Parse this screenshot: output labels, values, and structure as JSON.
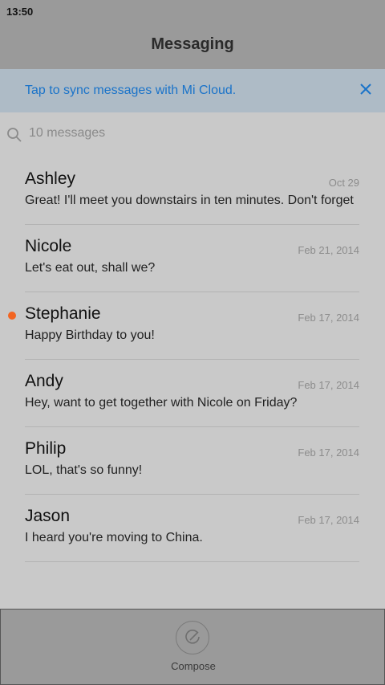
{
  "status_bar": {
    "time": "13:50"
  },
  "header": {
    "title": "Messaging"
  },
  "sync_banner": {
    "text": "Tap to sync messages with Mi Cloud.",
    "close_icon": "close-icon"
  },
  "search": {
    "placeholder": "10 messages",
    "icon": "search-icon"
  },
  "conversations": [
    {
      "name": "Ashley",
      "date": "Oct 29",
      "snippet": "Great! I'll meet you downstairs in ten minutes. Don't forget",
      "unread": false
    },
    {
      "name": "Nicole",
      "date": "Feb 21, 2014",
      "snippet": "Let's eat out, shall we?",
      "unread": false
    },
    {
      "name": "Stephanie",
      "date": "Feb 17, 2014",
      "snippet": "Happy Birthday to you!",
      "unread": true
    },
    {
      "name": "Andy",
      "date": "Feb 17, 2014",
      "snippet": "Hey, want to get together with Nicole on Friday?",
      "unread": false
    },
    {
      "name": "Philip",
      "date": "Feb 17, 2014",
      "snippet": "LOL, that's so funny!",
      "unread": false
    },
    {
      "name": "Jason",
      "date": "Feb 17, 2014",
      "snippet": "I heard you're moving to China.",
      "unread": false
    }
  ],
  "bottom_bar": {
    "compose_label": "Compose",
    "compose_icon": "compose-icon"
  },
  "colors": {
    "accent": "#1a73c9",
    "unread_dot": "#f26522",
    "overlay_header": "#9a9a9a",
    "background": "#c9c9c9"
  }
}
